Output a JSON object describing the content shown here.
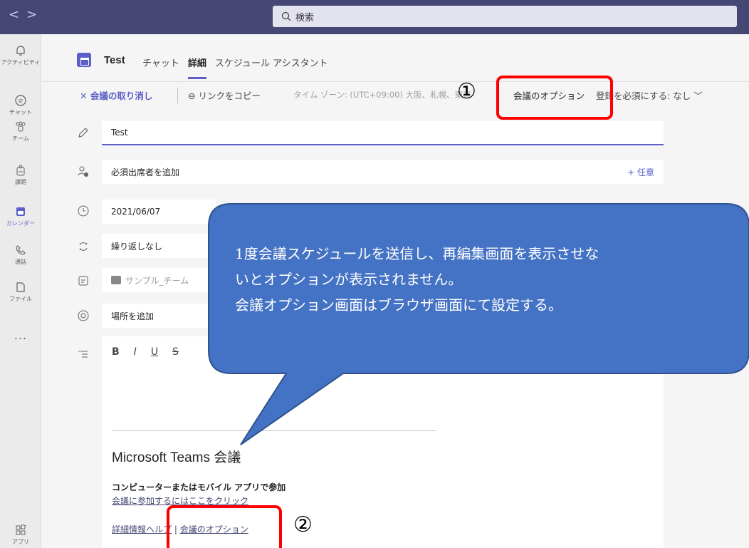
{
  "topbar": {
    "nav_back": "<",
    "nav_forward": ">",
    "search_placeholder": "検索"
  },
  "rail": {
    "items": [
      {
        "label": "アクティビティ",
        "icon": "bell-icon"
      },
      {
        "label": "チャット",
        "icon": "chat-icon"
      },
      {
        "label": "チーム",
        "icon": "teams-icon"
      },
      {
        "label": "課題",
        "icon": "assignments-icon"
      },
      {
        "label": "カレンダー",
        "icon": "calendar-icon"
      },
      {
        "label": "通話",
        "icon": "phone-icon"
      },
      {
        "label": "ファイル",
        "icon": "file-icon"
      },
      {
        "label": "アプリ",
        "icon": "apps-icon"
      }
    ],
    "more": "..."
  },
  "header": {
    "title": "Test",
    "tabs": [
      {
        "label": "チャット"
      },
      {
        "label": "詳細"
      },
      {
        "label": "スケジュール アシスタント"
      }
    ]
  },
  "toolbar": {
    "cancel_label": "会議の取り消し",
    "copy_link_label": "リンクをコピー",
    "timezone_label": "タイム ゾーン: (UTC+09:00) 大阪、札幌、東京",
    "options_label": "会議のオプション",
    "required_label": "登録を必須にする: なし"
  },
  "form": {
    "title_value": "Test",
    "attendees_placeholder": "必須出席者を追加",
    "optional_label": "+ 任意",
    "date_value": "2021/06/07",
    "repeat_value": "繰り返しなし",
    "channel_value": "サンプル_チーム",
    "location_placeholder": "場所を追加"
  },
  "editor": {
    "fmt_bold": "B",
    "fmt_italic": "I",
    "fmt_underline": "U",
    "fmt_strike": "S",
    "meeting_title": "Microsoft Teams 会議",
    "join_title": "コンピューターまたはモバイル アプリで参加",
    "join_link": "会議に参加するにはここをクリック",
    "help_link": "詳細情報ヘルプ",
    "separator": " | ",
    "options_link": "会議のオプション"
  },
  "annotations": {
    "num1": "①",
    "num2": "②",
    "callout_line1": "1度会議スケジュールを送信し、再編集画面を表示させな",
    "callout_line2": "いとオプションが表示されません。",
    "callout_line3": "会議オプション画面はブラウザ画面にて設定する。"
  },
  "colors": {
    "topbar": "#464775",
    "accent": "#5b5fc7",
    "highlight": "#ff0000",
    "callout_fill": "#4472c4",
    "callout_border": "#2f528f"
  }
}
